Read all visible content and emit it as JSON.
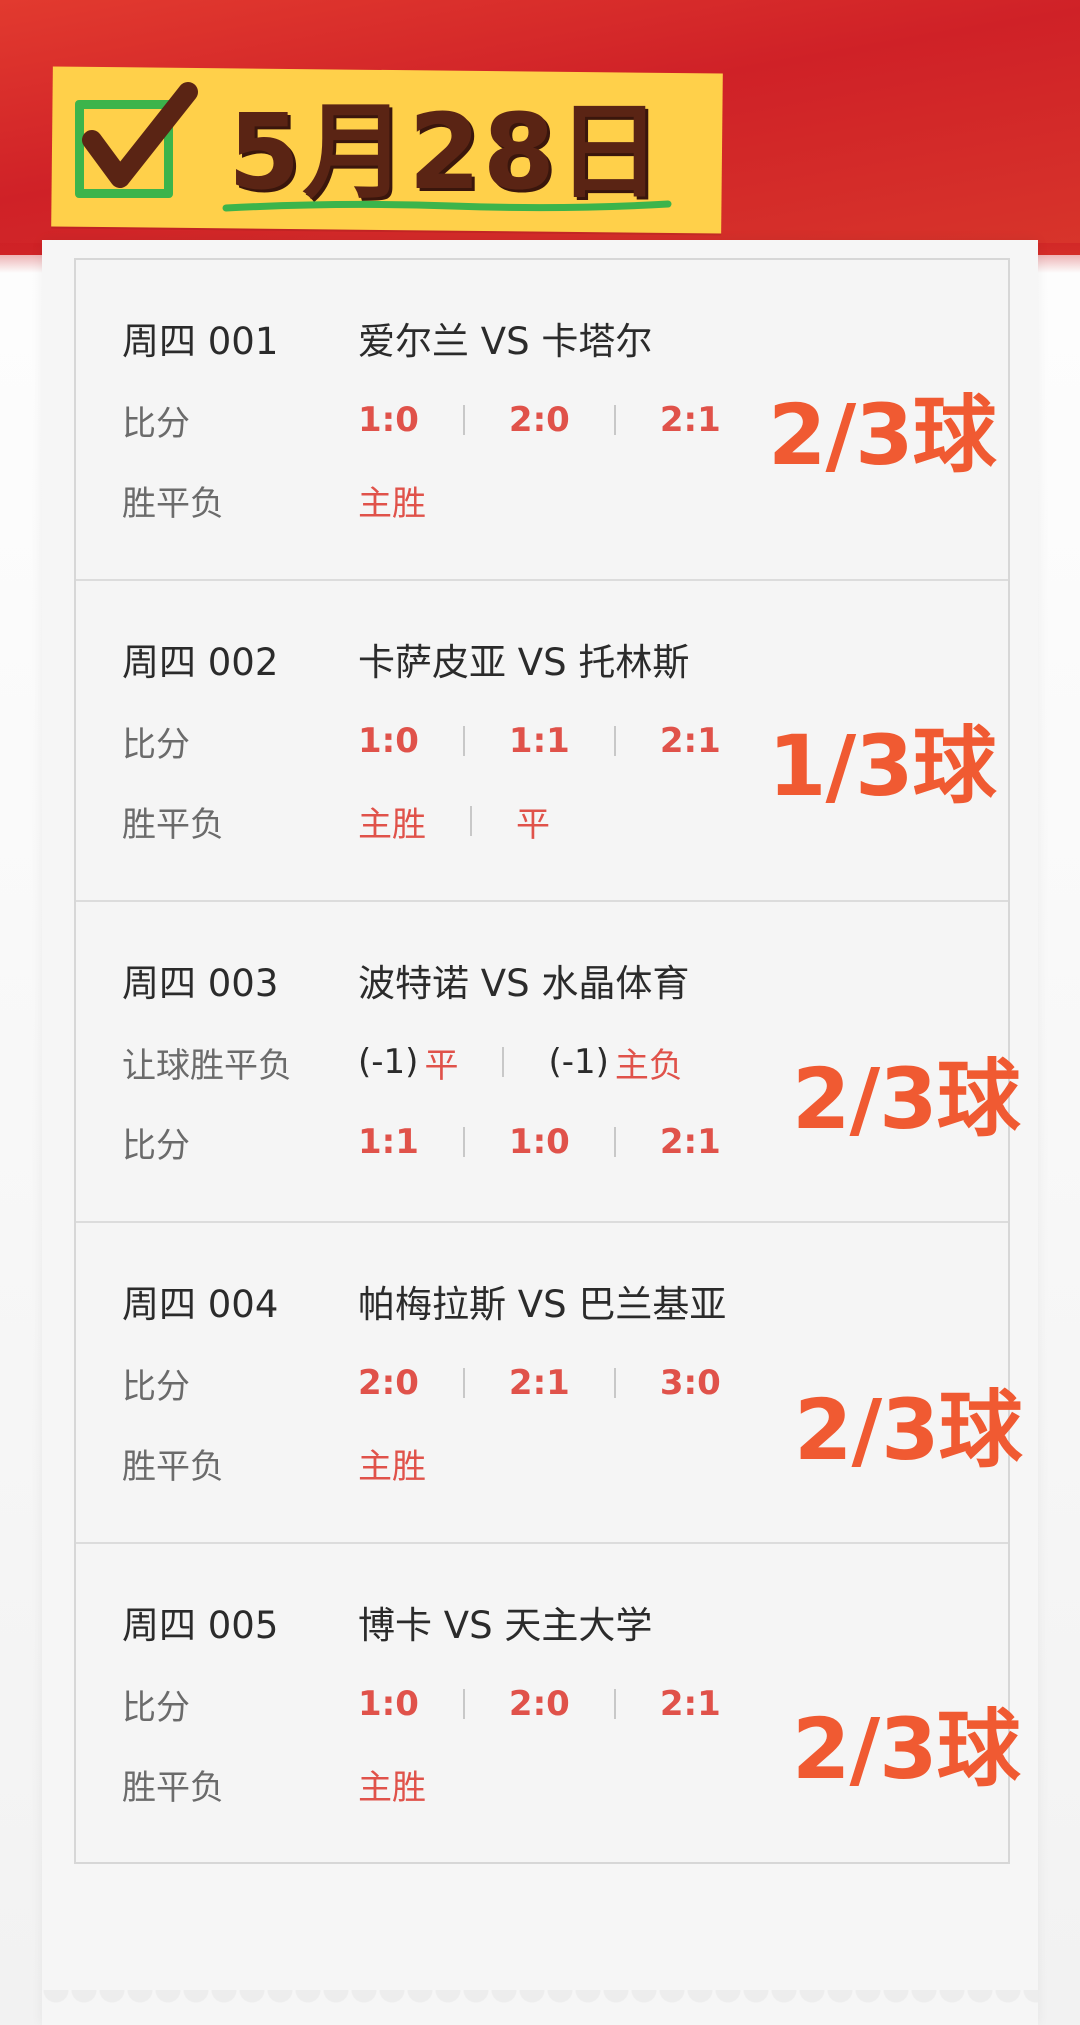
{
  "header": {
    "date": "5月28日",
    "colors": {
      "banner": "#d42a29",
      "tag": "#ffd04a",
      "check": "#3cb44b",
      "date_text": "#5a2414"
    },
    "check_icon": "checkbox-checked-icon"
  },
  "labels": {
    "score": "比分",
    "wdl": "胜平负",
    "handicap_wdl": "让球胜平负"
  },
  "matches": [
    {
      "code": "周四 001",
      "teams": "爱尔兰  VS  卡塔尔",
      "scores": [
        "1:0",
        "2:0",
        "2:1"
      ],
      "wdl": [
        "主胜"
      ],
      "result": "2/3球"
    },
    {
      "code": "周四 002",
      "teams": "卡萨皮亚  VS  托林斯",
      "scores": [
        "1:0",
        "1:1",
        "2:1"
      ],
      "wdl": [
        "主胜",
        "平"
      ],
      "result": "1/3球"
    },
    {
      "code": "周四 003",
      "teams": "波特诺  VS  水晶体育",
      "handicap": [
        {
          "line": "(-1)",
          "pick": "平"
        },
        {
          "line": "(-1)",
          "pick": "主负"
        }
      ],
      "scores": [
        "1:1",
        "1:0",
        "2:1"
      ],
      "result": "2/3球"
    },
    {
      "code": "周四 004",
      "teams": "帕梅拉斯  VS  巴兰基亚",
      "scores": [
        "2:0",
        "2:1",
        "3:0"
      ],
      "wdl": [
        "主胜"
      ],
      "result": "2/3球"
    },
    {
      "code": "周四 005",
      "teams": "博卡  VS  天主大学",
      "scores": [
        "1:0",
        "2:0",
        "2:1"
      ],
      "wdl": [
        "主胜"
      ],
      "result": "2/3球"
    }
  ],
  "colors": {
    "pick": "#e0524a",
    "result": "#f05a32"
  }
}
